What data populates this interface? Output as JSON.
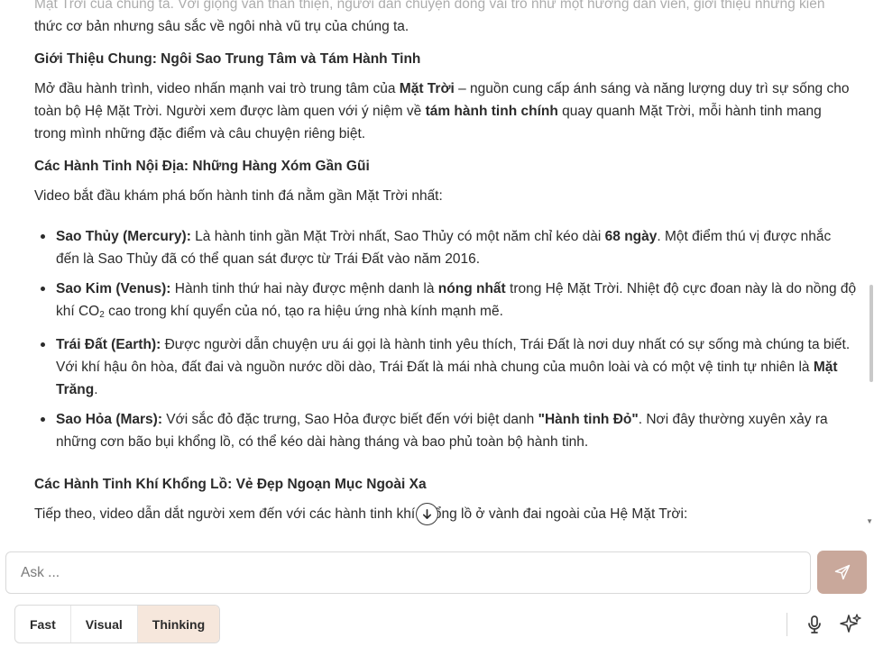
{
  "article": {
    "intro_cut": "Mặt Trời của chúng ta. Với giọng văn thân thiện, người dẫn chuyện đóng vai trò như một hướng dẫn viên, giới thiệu những kiến",
    "intro_end": "thức cơ bản nhưng sâu sắc về ngôi nhà vũ trụ của chúng ta.",
    "h1": "Giới Thiệu Chung: Ngôi Sao Trung Tâm và Tám Hành Tinh",
    "p1": {
      "a": "Mở đầu hành trình, video nhấn mạnh vai trò trung tâm của ",
      "b": "Mặt Trời",
      "c": " – nguồn cung cấp ánh sáng và năng lượng duy trì sự sống cho toàn bộ Hệ Mặt Trời. Người xem được làm quen với ý niệm về ",
      "d": "tám hành tinh chính",
      "e": " quay quanh Mặt Trời, mỗi hành tinh mang trong mình những đặc điểm và câu chuyện riêng biệt."
    },
    "h2": "Các Hành Tinh Nội Địa: Những Hàng Xóm Gần Gũi",
    "p2": "Video bắt đầu khám phá bốn hành tinh đá nằm gần Mặt Trời nhất:",
    "planets": [
      {
        "name": "Sao Thủy (Mercury):",
        "t1": " Là hành tinh gần Mặt Trời nhất, Sao Thủy có một năm chỉ kéo dài ",
        "b1": "68 ngày",
        "t2": ". Một điểm thú vị được nhắc đến là Sao Thủy đã có thể quan sát được từ Trái Đất vào năm 2016."
      },
      {
        "name": "Sao Kim (Venus):",
        "t1": " Hành tinh thứ hai này được mệnh danh là ",
        "b1": "nóng nhất",
        "t2": " trong Hệ Mặt Trời. Nhiệt độ cực đoan này là do nồng độ khí CO",
        "sub": "2",
        "t3": " cao trong khí quyển của nó, tạo ra hiệu ứng nhà kính mạnh mẽ."
      },
      {
        "name": "Trái Đất (Earth):",
        "t1": " Được người dẫn chuyện ưu ái gọi là hành tinh yêu thích, Trái Đất là nơi duy nhất có sự sống mà chúng ta biết. Với khí hậu ôn hòa, đất đai và nguồn nước dồi dào, Trái Đất là mái nhà chung của muôn loài và có một vệ tinh tự nhiên là ",
        "b1": "Mặt Trăng",
        "t2": "."
      },
      {
        "name": "Sao Hỏa (Mars):",
        "t1": " Với sắc đỏ đặc trưng, Sao Hỏa được biết đến với biệt danh ",
        "b1": "\"Hành tinh Đỏ\"",
        "t2": ". Nơi đây thường xuyên xảy ra những cơn bão bụi khổng lồ, có thể kéo dài hàng tháng và bao phủ toàn bộ hành tinh."
      }
    ],
    "h3": "Các Hành Tinh Khí Khổng Lồ: Vẻ Đẹp Ngoạn Mục Ngoài Xa",
    "p3": "Tiếp theo, video dẫn dắt người xem đến với các hành tinh khí khổng lồ ở vành đai ngoài của Hệ Mặt Trời:"
  },
  "composer": {
    "placeholder": "Ask ...",
    "modes": [
      "Fast",
      "Visual",
      "Thinking"
    ],
    "active_mode": "Thinking"
  },
  "colors": {
    "send_button": "#c9a89b",
    "active_mode_bg": "#f6e7dc",
    "text": "#2b2b2b"
  },
  "icons": {
    "scroll_down": "arrow-down-circle-icon",
    "send": "paper-plane-icon",
    "mic": "microphone-icon",
    "sparkle": "sparkle-icon"
  }
}
